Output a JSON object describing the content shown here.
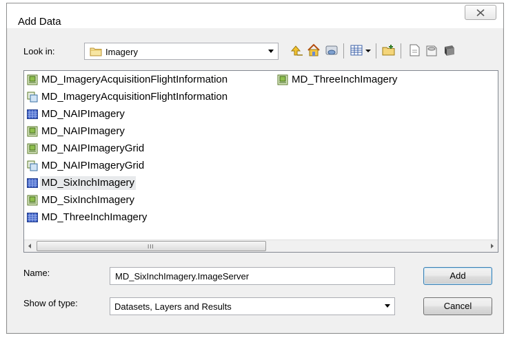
{
  "window": {
    "title": "Add Data"
  },
  "toolbar": {
    "look_in_label": "Look in:",
    "look_in_value": "Imagery"
  },
  "list": {
    "items": [
      {
        "label": "MD_ImageryAcquisitionFlightInformation",
        "icon": "image-service-icon"
      },
      {
        "label": "MD_ImageryAcquisitionFlightInformation",
        "icon": "map-service-icon"
      },
      {
        "label": "MD_NAIPImagery",
        "icon": "raster-dataset-icon"
      },
      {
        "label": "MD_NAIPImagery",
        "icon": "image-service-icon"
      },
      {
        "label": "MD_NAIPImageryGrid",
        "icon": "image-service-icon"
      },
      {
        "label": "MD_NAIPImageryGrid",
        "icon": "map-service-icon"
      },
      {
        "label": "MD_SixInchImagery",
        "icon": "raster-dataset-icon"
      },
      {
        "label": "MD_SixInchImagery",
        "icon": "image-service-icon"
      },
      {
        "label": "MD_ThreeInchImagery",
        "icon": "raster-dataset-icon"
      },
      {
        "label": "MD_ThreeInchImagery",
        "icon": "image-service-icon"
      }
    ],
    "selected_label": "MD_SixInchImagery"
  },
  "form": {
    "name_label": "Name:",
    "name_value": "MD_SixInchImagery.ImageServer",
    "type_label": "Show of type:",
    "type_value": "Datasets, Layers and Results"
  },
  "buttons": {
    "add": "Add",
    "cancel": "Cancel"
  },
  "scrollbar": {
    "grip": "III"
  },
  "colors": {
    "dialog_bg": "#f0f0f0",
    "selection_bg": "#e8eaec",
    "default_button_border": "#3c7fb1"
  }
}
